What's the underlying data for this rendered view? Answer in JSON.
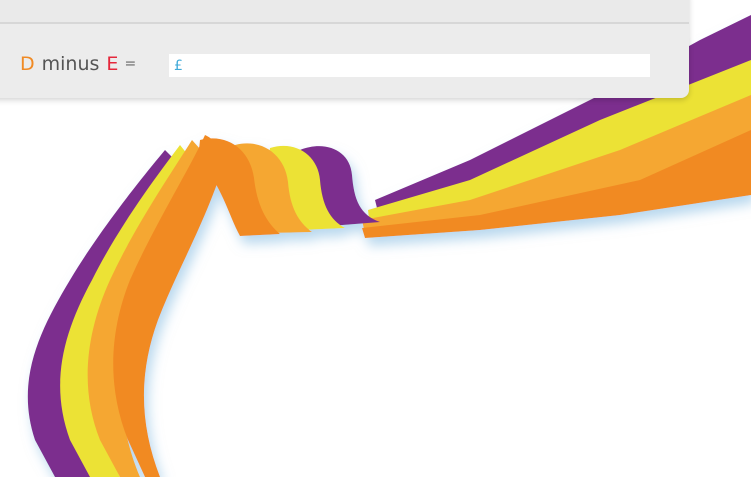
{
  "formula": {
    "letter_d": "D",
    "operator_word": "minus",
    "letter_e": "E",
    "equals": "="
  },
  "amount_field": {
    "currency_symbol": "£",
    "value": "",
    "placeholder": ""
  },
  "colors": {
    "letter_d": "#f08a24",
    "letter_e": "#e5273b",
    "currency_symbol": "#3fa9d8",
    "ribbon_purple": "#7b2f8e",
    "ribbon_yellow": "#ece236",
    "ribbon_orange_light": "#f5a732",
    "ribbon_orange": "#f18a23",
    "panel_bg": "#ececec"
  }
}
